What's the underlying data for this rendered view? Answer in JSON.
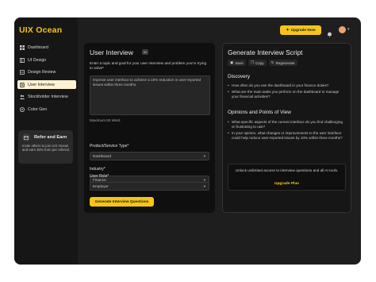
{
  "app": {
    "logo": "UIX Ocean"
  },
  "sidebar": {
    "items": [
      {
        "label": "Dashboard",
        "icon": "grid-icon"
      },
      {
        "label": "UI Design",
        "icon": "layout-icon"
      },
      {
        "label": "Design Review",
        "icon": "review-icon"
      },
      {
        "label": "User Interview",
        "icon": "document-icon",
        "active": true
      },
      {
        "label": "Stockholder Interview",
        "icon": "people-icon"
      },
      {
        "label": "Color Gen",
        "icon": "palette-icon"
      }
    ],
    "refer": {
      "title": "Refer and Earn",
      "description": "Invite others to join UIX Ocean and earn 30% from per referral."
    }
  },
  "topbar": {
    "upgrade_label": "Upgrade Now"
  },
  "interview": {
    "title": "User Interview",
    "badge": "AI",
    "prompt": "Enter a topic and goal for your user interview and problem you're trying to solve*",
    "textarea_value": "Improve user interface to achieve a 10% reduction in user-reported issues within three months.",
    "max_words": "Maximum 50 Word",
    "fields": [
      {
        "label": "Product/Service Type*",
        "value": "Dashboard"
      },
      {
        "label": "Industry*",
        "value": "Finance"
      },
      {
        "label": "User Role*",
        "value": "Employer"
      }
    ],
    "generate_label": "Generate Interview Questions"
  },
  "script": {
    "title": "Generate Interview Script",
    "actions": [
      "Save",
      "Copy",
      "Regenerate"
    ],
    "sections": [
      {
        "title": "Discovery",
        "bullets": [
          "How often do you use the dashboard in your finance duties?",
          "What are the main tasks you perform on the dashboard to manage your financial activities?"
        ]
      },
      {
        "title": "Opinions and Points of View",
        "bullets": [
          "What specific aspects of the current interface do you find challenging or frustrating to use?",
          "In your opinion, what changes or improvements to the user interface could help reduce user-reported issues by 10% within three months?"
        ]
      }
    ],
    "upgrade_text": "Unlock unlimited access to interview questions and all AI tools.",
    "upgrade_link": "Upgrade Plan"
  },
  "colors": {
    "accent": "#f5c518",
    "background": "#1e1e1e",
    "active_nav": "#fdf2d3"
  }
}
